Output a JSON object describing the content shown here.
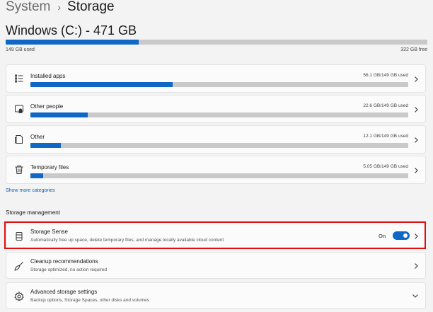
{
  "breadcrumb": {
    "parent": "System",
    "separator": "›",
    "current": "Storage"
  },
  "drive": {
    "title": "Windows (C:) - 471 GB",
    "used_label": "149 GB used",
    "free_label": "322 GB free",
    "used_fraction": 0.316
  },
  "categories": [
    {
      "label": "Installed apps",
      "size": "56.1 GB/149 GB used",
      "icon": "apps-list-icon",
      "fraction": 0.376
    },
    {
      "label": "Other people",
      "size": "22.6 GB/149 GB used",
      "icon": "people-icon",
      "fraction": 0.152
    },
    {
      "label": "Other",
      "size": "12.1 GB/149 GB used",
      "icon": "document-icon",
      "fraction": 0.081
    },
    {
      "label": "Temporary files",
      "size": "5.05 GB/149 GB used",
      "icon": "trash-icon",
      "fraction": 0.034
    }
  ],
  "show_more": "Show more categories",
  "storage_management": {
    "title": "Storage management",
    "items": [
      {
        "title": "Storage Sense",
        "desc": "Automatically free up space, delete temporary files, and manage locally available cloud content",
        "toggle_label": "On",
        "toggle_on": true,
        "icon": "storage-drive-icon"
      },
      {
        "title": "Cleanup recommendations",
        "desc": "Storage optimized, no action required",
        "icon": "broom-icon"
      },
      {
        "title": "Advanced storage settings",
        "desc": "Backup options, Storage Spaces, other disks and volumes",
        "icon": "gear-icon"
      }
    ]
  },
  "colors": {
    "accent": "#0f67c6",
    "highlight": "#e01010",
    "bar_bg": "#c9c9c9"
  }
}
